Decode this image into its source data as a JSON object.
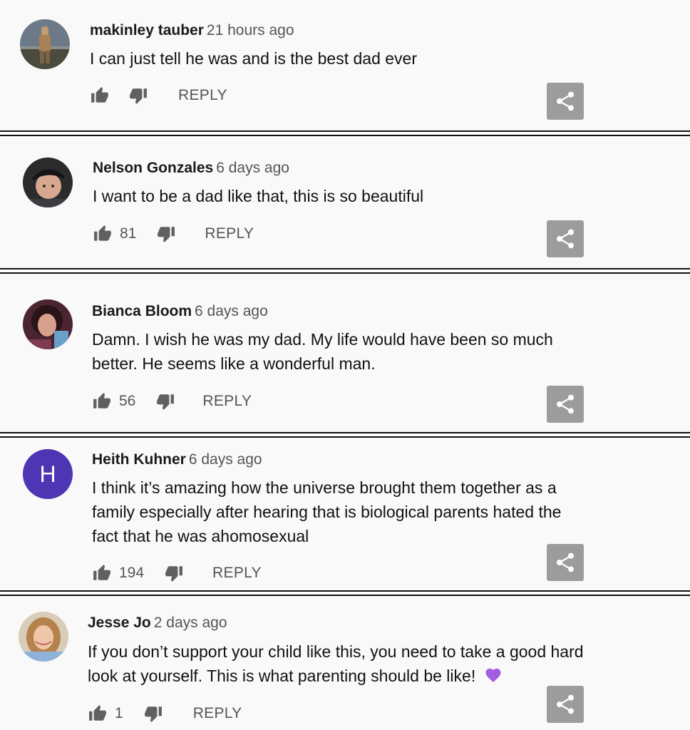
{
  "comments": [
    {
      "author": "makinley tauber",
      "time": "21 hours ago",
      "lines": [
        "I can just tell he was and is the best dad ever"
      ],
      "likes": "",
      "reply": "REPLY",
      "avatar": "photo-avatar"
    },
    {
      "author": "Nelson Gonzales",
      "time": "6 days ago",
      "lines": [
        "I want to be a dad like that, this is so beautiful"
      ],
      "likes": "81",
      "reply": "REPLY",
      "avatar": "photo-avatar"
    },
    {
      "author": "Bianca Bloom",
      "time": "6 days ago",
      "lines": [
        "Damn. I wish he was my dad. My life would have been so much",
        "better. He seems like a wonderful man."
      ],
      "likes": "56",
      "reply": "REPLY",
      "avatar": "photo-avatar"
    },
    {
      "author": "Heith Kuhner",
      "time": "6 days ago",
      "lines": [
        "I think it’s amazing how the universe brought them together as a",
        "family especially after hearing that is biological parents hated the",
        "fact that he was ahomosexual"
      ],
      "likes": "194",
      "reply": "REPLY",
      "avatar_letter": "H",
      "avatar_color": "#4e35b4"
    },
    {
      "author": "Jesse Jo",
      "time": "2 days ago",
      "lines": [
        "If you don’t support your child like this, you need to take a good hard",
        "look at yourself. This is what parenting should be like!"
      ],
      "likes": "1",
      "reply": "REPLY",
      "avatar": "photo-avatar",
      "emoji": "purple-heart"
    }
  ],
  "icons": {
    "like": "thumb-up-icon",
    "dislike": "thumb-down-icon",
    "share": "share-icon"
  },
  "colors": {
    "background": "#f9f9f9",
    "share_button": "#9c9c9c",
    "muted_text": "#555555",
    "heart": "#a35ee0"
  }
}
